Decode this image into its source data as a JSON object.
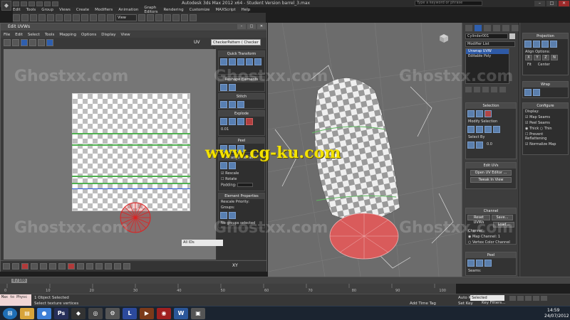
{
  "app": {
    "window_title": "Autodesk 3ds Max  2012 x64  -  Student Version   barrel_3.max",
    "search_placeholder": "Type a keyword or phrase",
    "menu": [
      "Edit",
      "Tools",
      "Group",
      "Views",
      "Create",
      "Modifiers",
      "Animation",
      "Graph Editors",
      "Rendering",
      "Customize",
      "MAXScript",
      "Help"
    ],
    "view_dropdown": "View"
  },
  "uv_editor": {
    "title": "Edit UVWs",
    "menu": [
      "File",
      "Edit",
      "Select",
      "Tools",
      "Mapping",
      "Options",
      "Display",
      "View"
    ],
    "uv_label": "UV",
    "checker_pattern": "CheckerPattern  ( Checker )",
    "coord_label": "XY",
    "all_ids": "All IDs",
    "panel": {
      "quick_transform": "Quick Transform",
      "reshape_elements": "Reshape Elements",
      "stitch": "Stitch",
      "explode": "Explode",
      "weld_threshold": "0.01",
      "peel": "Peel",
      "arrange_elements": "Arrange Elements",
      "rescale": "Rescale",
      "rotate": "Rotate",
      "padding_label": "Padding:",
      "element_properties": "Element Properties",
      "rescale_priority": "Rescale Priority:",
      "groups_label": "Groups:",
      "no_groups": "No groups selected"
    }
  },
  "command_panel": {
    "object_name": "Cylinder001",
    "modifier_list": "Modifier List",
    "stack": [
      "Unwrap UVW",
      "Editable Poly"
    ],
    "selection_head": "Selection",
    "modify_selection": "Modify Selection",
    "select_by": "Select By",
    "select_by_value": "0.0",
    "edit_uvs_head": "Edit UVs",
    "open_uv_editor": "Open UV Editor ...",
    "tweak_in_view": "Tweak In View",
    "channel_head": "Channel",
    "reset_uvws": "Reset UVWs",
    "save": "Save...",
    "load": "Load...",
    "channel_label": "Channel:",
    "map_channel": "Map Channel:",
    "map_channel_value": "1",
    "vertex_color_channel": "Vertex Color Channel",
    "peel_head": "Peel",
    "seams_label": "Seams:"
  },
  "right_panel": {
    "projection_head": "Projection",
    "align_options": "Align Options:",
    "align_buttons": [
      "X",
      "Y",
      "Z",
      "N"
    ],
    "fit": "Fit",
    "center": "Center",
    "wrap_head": "Wrap",
    "configure_head": "Configure",
    "display_label": "Display:",
    "map_seams": "Map Seams",
    "peel_seams": "Peel Seams",
    "thick": "Thick",
    "thin": "Thin",
    "prevent_reflattening": "Prevent Reflattening",
    "normalize_map": "Normalize Map"
  },
  "timeline": {
    "frame": "0 / 100",
    "ticks": [
      "0",
      "10",
      "20",
      "30",
      "40",
      "50",
      "60",
      "70",
      "80",
      "90",
      "100"
    ]
  },
  "status": {
    "maxscript": "Max to Physc",
    "objects_selected": "1 Object Selected",
    "hint": "Select texture vertices",
    "add_time_tag": "Add Time Tag",
    "auto_key": "Auto Key",
    "selected": "Selected",
    "set_key": "Set Key",
    "key_filters": "Key Filters..."
  },
  "taskbar": {
    "time": "14:59",
    "date": "24/07/2012"
  },
  "watermarks": {
    "ghostxx": "Ghostxx.com",
    "cgku": "www.cg-ku.com"
  }
}
